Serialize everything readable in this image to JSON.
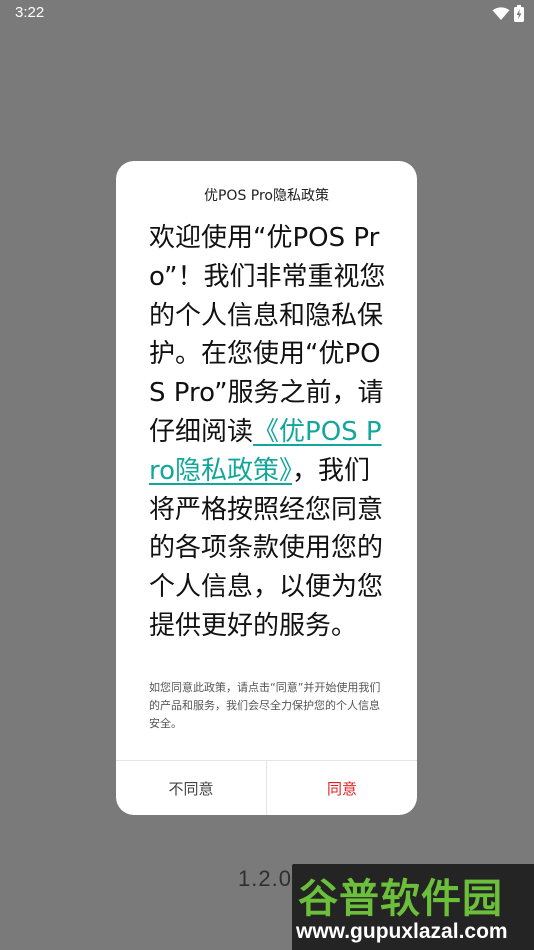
{
  "status_bar": {
    "time": "3:22",
    "icons": [
      "wifi-icon",
      "battery-charging-icon"
    ]
  },
  "dialog": {
    "title": "优POS Pro隐私政策",
    "body_intro": "欢迎使用“优POS Pro”！我们非常重视您的个人信息和隐私保护。在您使用“优POS Pro”服务之前，请仔细阅读",
    "policy_link": "《优POS Pro隐私政策》",
    "body_outro": "，我们将严格按照经您同意的各项条款使用您的个人信息，以便为您提供更好的服务。",
    "note": "如您同意此政策，请点击“同意”并开始使用我们的产品和服务，我们会尽全力保护您的个人信息安全。",
    "disagree_label": "不同意",
    "agree_label": "同意"
  },
  "version": "1.2.0",
  "watermark": {
    "title": "谷普软件园",
    "url": "www.gupuxlazal.com"
  },
  "colors": {
    "overlay": "#7a7a7a",
    "link": "#13a79a",
    "agree": "#e02020"
  }
}
